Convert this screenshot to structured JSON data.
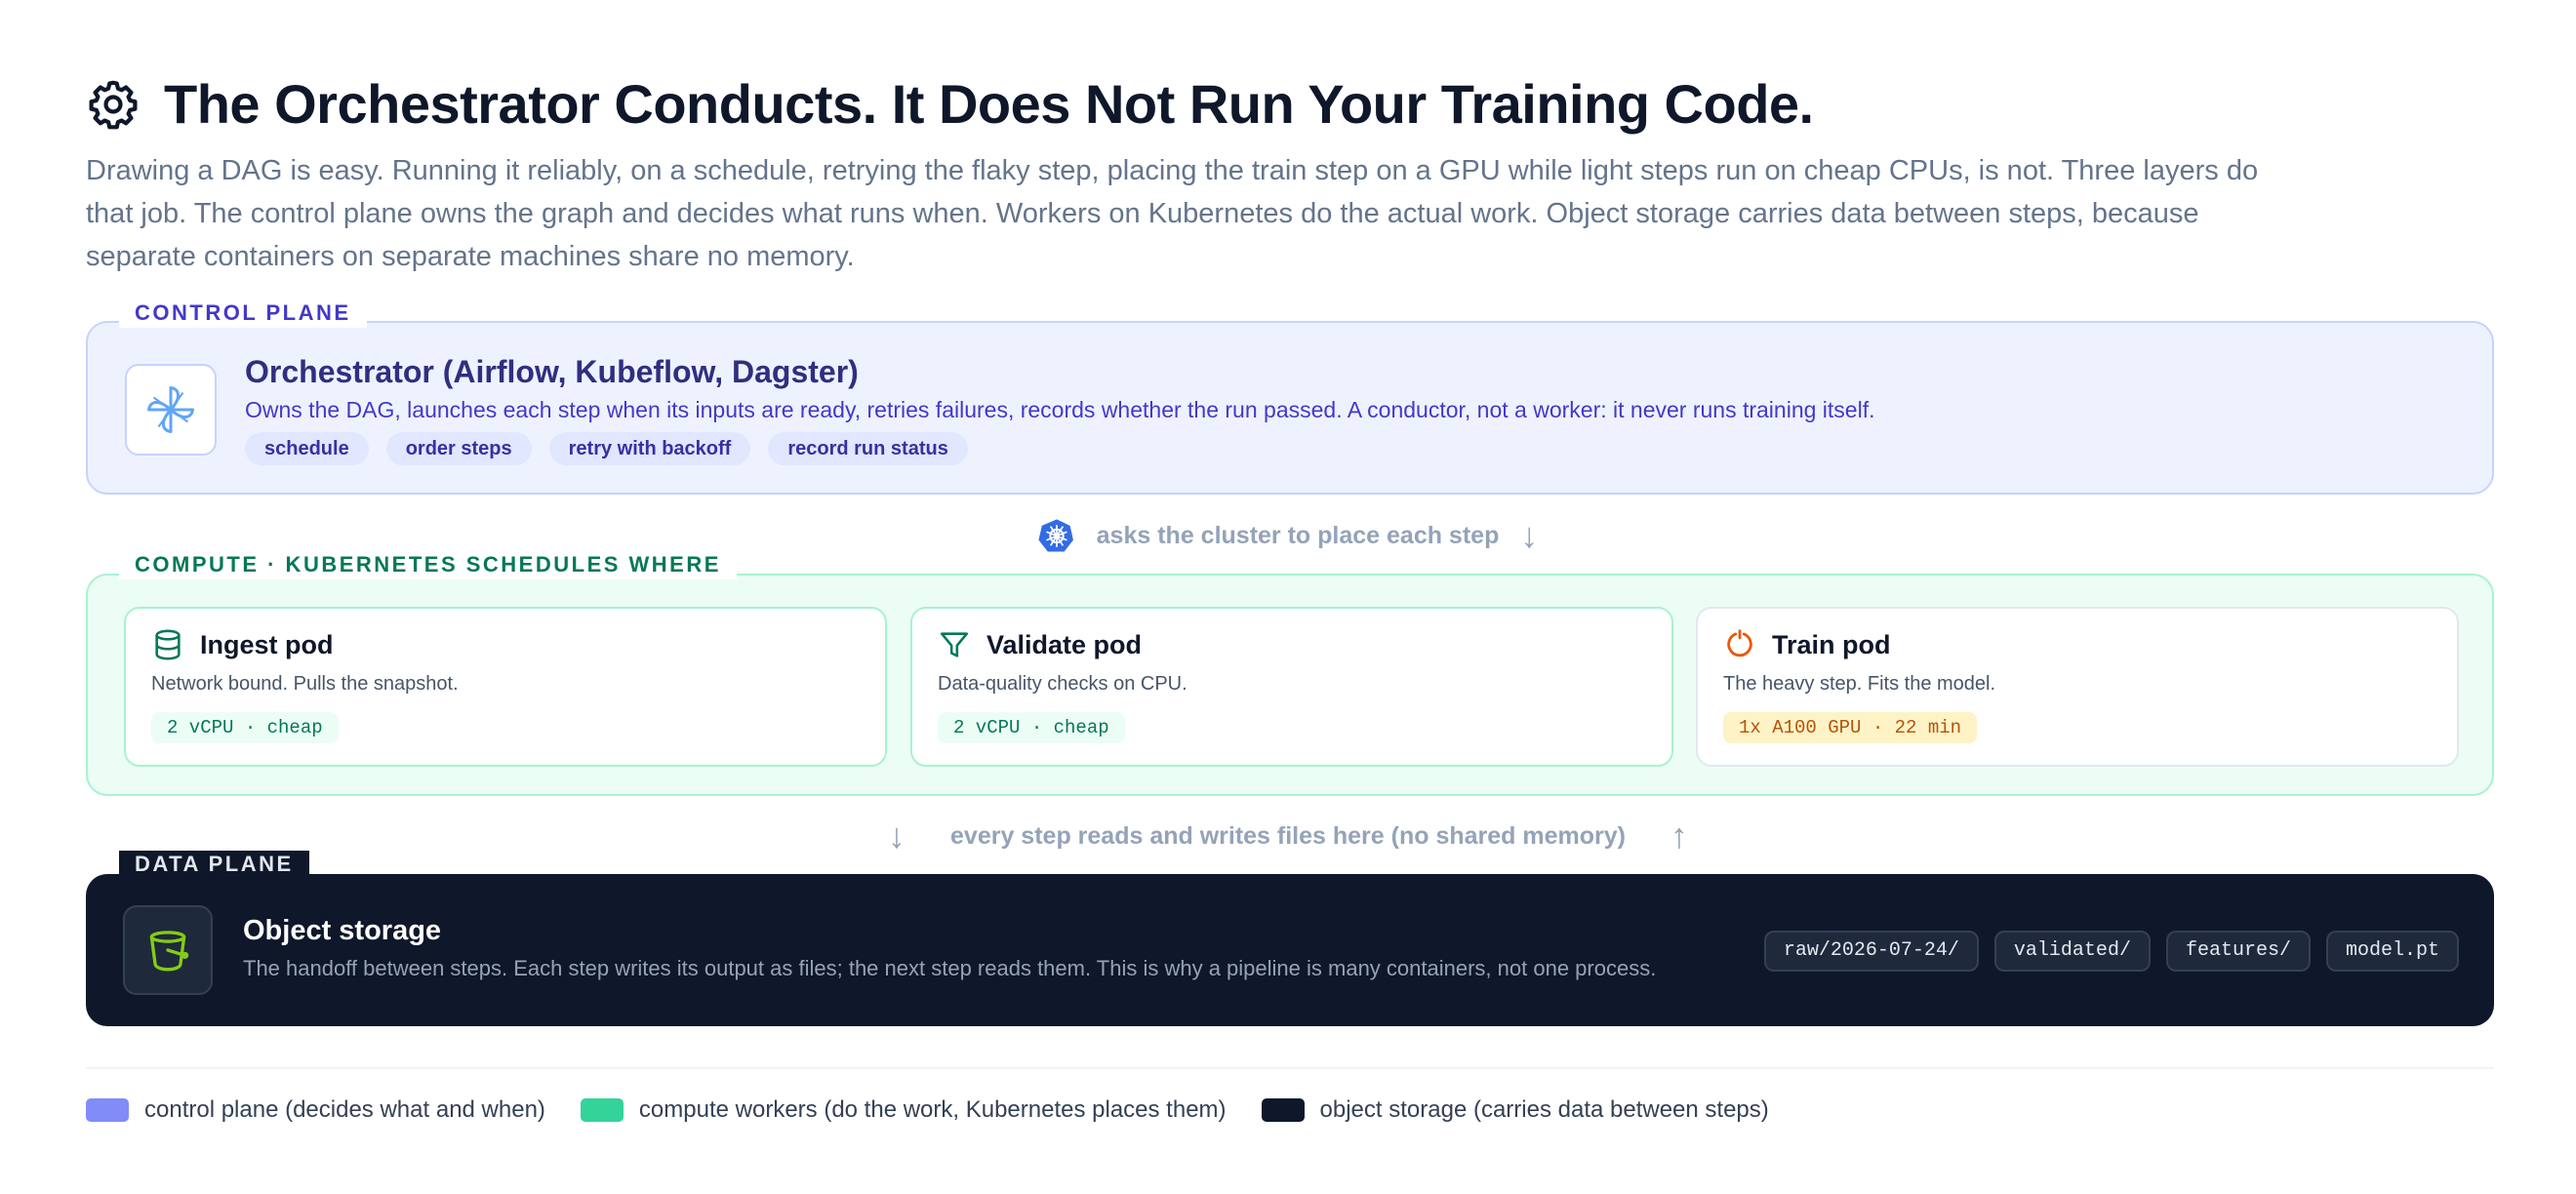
{
  "header": {
    "title": "The Orchestrator Conducts. It Does Not Run Your Training Code.",
    "subtitle": "Drawing a DAG is easy. Running it reliably, on a schedule, retrying the flaky step, placing the train step on a GPU while light steps run on cheap CPUs, is not. Three layers do that job. The control plane owns the graph and decides what runs when. Workers on Kubernetes do the actual work. Object storage carries data between steps, because separate containers on separate machines share no memory.",
    "icon": "gear-icon"
  },
  "control_plane": {
    "tag": "CONTROL PLANE",
    "icon": "pinwheel-icon",
    "title": "Orchestrator (Airflow, Kubeflow, Dagster)",
    "description": "Owns the DAG, launches each step when its inputs are ready, retries failures, records whether the run passed. A conductor, not a worker: it never runs training itself.",
    "chips": [
      "schedule",
      "order steps",
      "retry with backoff",
      "record run status"
    ]
  },
  "connector_top": {
    "icon": "kubernetes-icon",
    "text": "asks the cluster to place each step",
    "arrow": "↓"
  },
  "compute": {
    "tag": "COMPUTE · KUBERNETES SCHEDULES WHERE",
    "pods": [
      {
        "icon": "database-icon",
        "title": "Ingest pod",
        "description": "Network bound. Pulls the snapshot.",
        "spec": "2 vCPU · cheap"
      },
      {
        "icon": "filter-icon",
        "title": "Validate pod",
        "description": "Data-quality checks on CPU.",
        "spec": "2 vCPU · cheap"
      },
      {
        "icon": "spinner-icon",
        "title": "Train pod",
        "description": "The heavy step. Fits the model.",
        "spec": "1x A100 GPU · 22 min"
      }
    ]
  },
  "connector_bottom": {
    "left_arrow": "↓",
    "text": "every step reads and writes files here (no shared memory)",
    "right_arrow": "↑"
  },
  "data_plane": {
    "tag": "DATA PLANE",
    "icon": "bucket-icon",
    "title": "Object storage",
    "description": "The handoff between steps. Each step writes its output as files; the next step reads them. This is why a pipeline is many containers, not one process.",
    "paths": [
      "raw/2026-07-24/",
      "validated/",
      "features/",
      "model.pt"
    ]
  },
  "legend": [
    {
      "label": "control plane (decides what and when)",
      "color": "#818cf8"
    },
    {
      "label": "compute workers (do the work, Kubernetes places them)",
      "color": "#34d399"
    },
    {
      "label": "object storage (carries data between steps)",
      "color": "#0f172a"
    }
  ]
}
